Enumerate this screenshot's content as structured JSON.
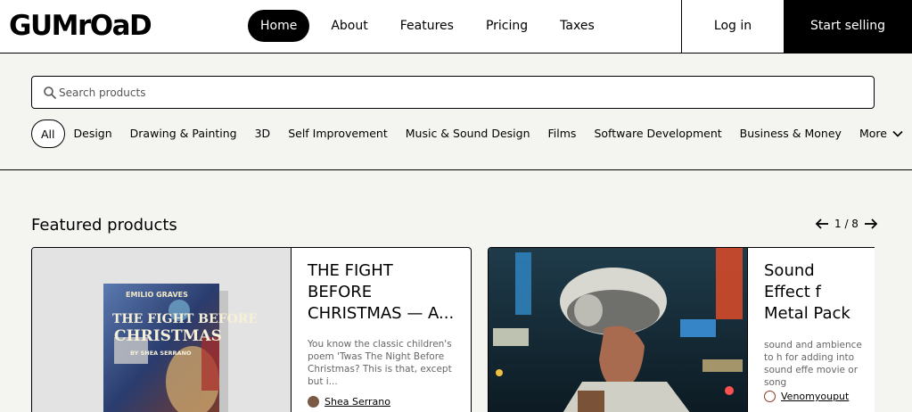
{
  "brand": {
    "logo": "GUMrOaD"
  },
  "nav": [
    {
      "label": "Home",
      "active": true
    },
    {
      "label": "About"
    },
    {
      "label": "Features"
    },
    {
      "label": "Pricing"
    },
    {
      "label": "Taxes"
    }
  ],
  "auth": {
    "login": "Log in",
    "start": "Start selling"
  },
  "search": {
    "placeholder": "Search products",
    "icon": "search-icon"
  },
  "categories": [
    "All",
    "Design",
    "Drawing & Painting",
    "3D",
    "Self Improvement",
    "Music & Sound Design",
    "Films",
    "Software Development",
    "Business & Money",
    "More"
  ],
  "featured": {
    "title": "Featured products",
    "pager": "1 / 8",
    "products": [
      {
        "title": "THE FIGHT BEFORE CHRISTMAS — A...",
        "description": "You know the classic children's poem 'Twas The Night Before Christmas? This is that, except but i...",
        "seller": "Shea Serrano",
        "cover_text": [
          "EMILIO GRAVES",
          "THE FIGHT BEFORE",
          "CHRISTMAS",
          "BY SHEA SERRANO"
        ]
      },
      {
        "title": "Sound Effect f Metal Pack",
        "description": "sound and ambience to h for adding into sound effe movie or song",
        "seller": "Venomyouput"
      }
    ]
  }
}
